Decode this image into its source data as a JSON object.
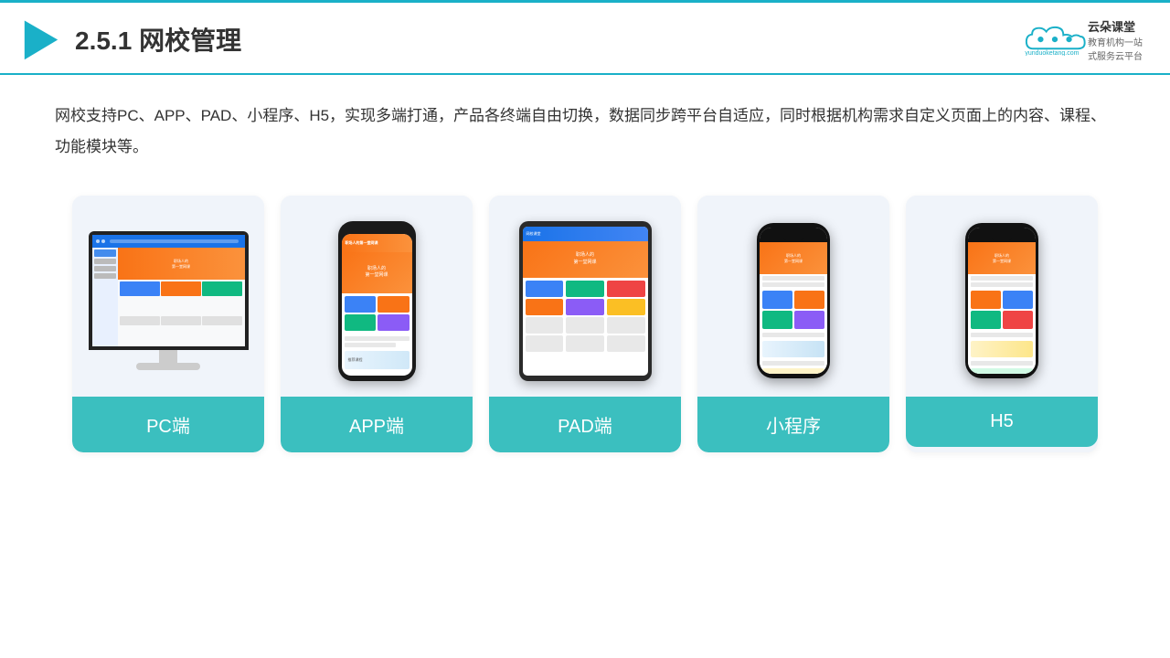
{
  "header": {
    "section_number": "2.5.1",
    "title": "网校管理",
    "brand_name": "云朵课堂",
    "brand_url": "yunduoketang.com",
    "brand_slogan": "教育机构一站\n式服务云平台"
  },
  "description": {
    "text": "网校支持PC、APP、PAD、小程序、H5，实现多端打通，产品各终端自由切换，数据同步跨平台自适应，同时根据机构需求自定义页面上的内容、课程、功能模块等。"
  },
  "cards": [
    {
      "id": "pc",
      "label": "PC端"
    },
    {
      "id": "app",
      "label": "APP端"
    },
    {
      "id": "pad",
      "label": "PAD端"
    },
    {
      "id": "miniapp",
      "label": "小程序"
    },
    {
      "id": "h5",
      "label": "H5"
    }
  ],
  "colors": {
    "teal": "#3bbfbf",
    "header_blue": "#1ab0c8",
    "orange": "#f97316",
    "blue": "#1a73e8",
    "card_bg": "#f0f4fa"
  }
}
